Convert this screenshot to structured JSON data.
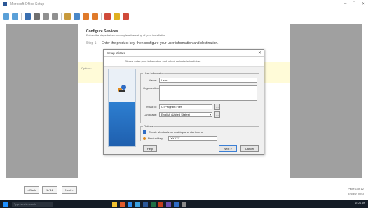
{
  "window": {
    "title": "Microsoft Office Setup"
  },
  "toolbar": {
    "buttons": [
      {
        "icon": "undo-icon",
        "color": "#5aa0d8"
      },
      {
        "icon": "redo-icon",
        "color": "#5aa0d8"
      },
      {
        "icon": "save-icon",
        "color": "#3a6fb0"
      },
      {
        "icon": "print-icon",
        "color": "#707070"
      },
      {
        "icon": "cut-icon",
        "color": "#909090"
      },
      {
        "icon": "copy-icon",
        "color": "#909090"
      },
      {
        "icon": "paste-icon",
        "color": "#c89a3c"
      },
      {
        "icon": "find-icon",
        "color": "#4a88c8"
      },
      {
        "icon": "image-icon",
        "color": "#e07a2a"
      },
      {
        "icon": "table-icon",
        "color": "#e07a2a"
      },
      {
        "icon": "chart-icon",
        "color": "#d04a3a"
      },
      {
        "icon": "star-icon",
        "color": "#e0b020"
      },
      {
        "icon": "flag-icon",
        "color": "#d04a3a"
      }
    ]
  },
  "page": {
    "heading": "Configure Services",
    "subtitle": "Follow the steps below to complete the setup of your installation.",
    "step_number": "Step 1:",
    "step_text": "Enter the product key, then configure your user information and destination.",
    "left_note": "Options:"
  },
  "dialog": {
    "title": "Setup Wizard",
    "banner_text": "Please enter your information and select an installation folder.",
    "group1_label": "User Information",
    "name_label": "Name:",
    "name_value": "User",
    "org_label": "Organization:",
    "org_value": "",
    "install_label": "Install to:",
    "install_value": "C:\\Program Files",
    "language_label": "Language:",
    "language_value": "English (United States)",
    "group2_label": "Options",
    "check1": "Create shortcuts on desktop and start menu",
    "check2_label": "Product key:",
    "check2_value": "XXXXX",
    "btn_help": "Help",
    "btn_next": "Next >",
    "btn_cancel": "Cancel"
  },
  "navbar": {
    "btn_prev": "< Back",
    "btn_page": "1 / 12",
    "btn_next": "Next >",
    "right_top": "Page 1 of 12",
    "right_bottom": "English (US)"
  },
  "taskbar": {
    "search_text": "Type here to search",
    "icons": [
      "#f0c030",
      "#e05a2a",
      "#2d8cf0",
      "#3aa0e0",
      "#2b5797",
      "#1e7145",
      "#c43e1c",
      "#6a4fb0",
      "#2f6cc4",
      "#8a8a8a"
    ],
    "clock": "10:24 AM"
  }
}
